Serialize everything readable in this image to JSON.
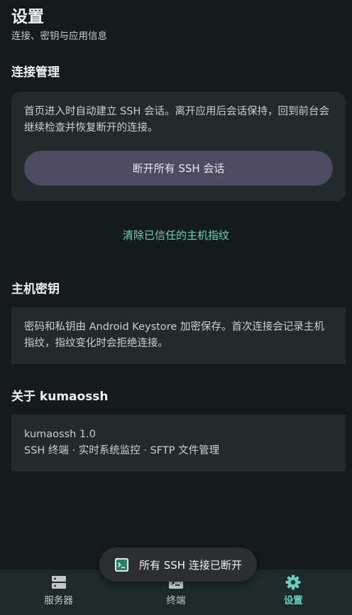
{
  "header": {
    "title": "设置",
    "subtitle": "连接、密钥与应用信息"
  },
  "connection": {
    "title": "连接管理",
    "description": "首页进入时自动建立 SSH 会话。离开应用后会话保持，回到前台会继续检查并恢复断开的连接。",
    "disconnect_label": "断开所有 SSH 会话",
    "clear_label": "清除已信任的主机指纹"
  },
  "keys": {
    "title": "主机密钥",
    "description": "密码和私钥由 Android Keystore 加密保存。首次连接会记录主机指纹，指纹变化时会拒绝连接。"
  },
  "about": {
    "title": "关于 kumaossh",
    "version": "kumaossh 1.0",
    "features": "SSH 终端 · 实时系统监控 · SFTP 文件管理"
  },
  "toast": {
    "icon": "terminal-icon",
    "text": "所有 SSH 连接已断开"
  },
  "nav": {
    "items": [
      {
        "label": "服务器",
        "icon": "server-icon"
      },
      {
        "label": "终端",
        "icon": "terminal-icon"
      },
      {
        "label": "设置",
        "icon": "gear-icon"
      }
    ],
    "active": "设置"
  },
  "colors": {
    "accent": "#67d1bf",
    "background": "#151a1b",
    "card": "#222b2b",
    "button": "#4e4a5f"
  }
}
